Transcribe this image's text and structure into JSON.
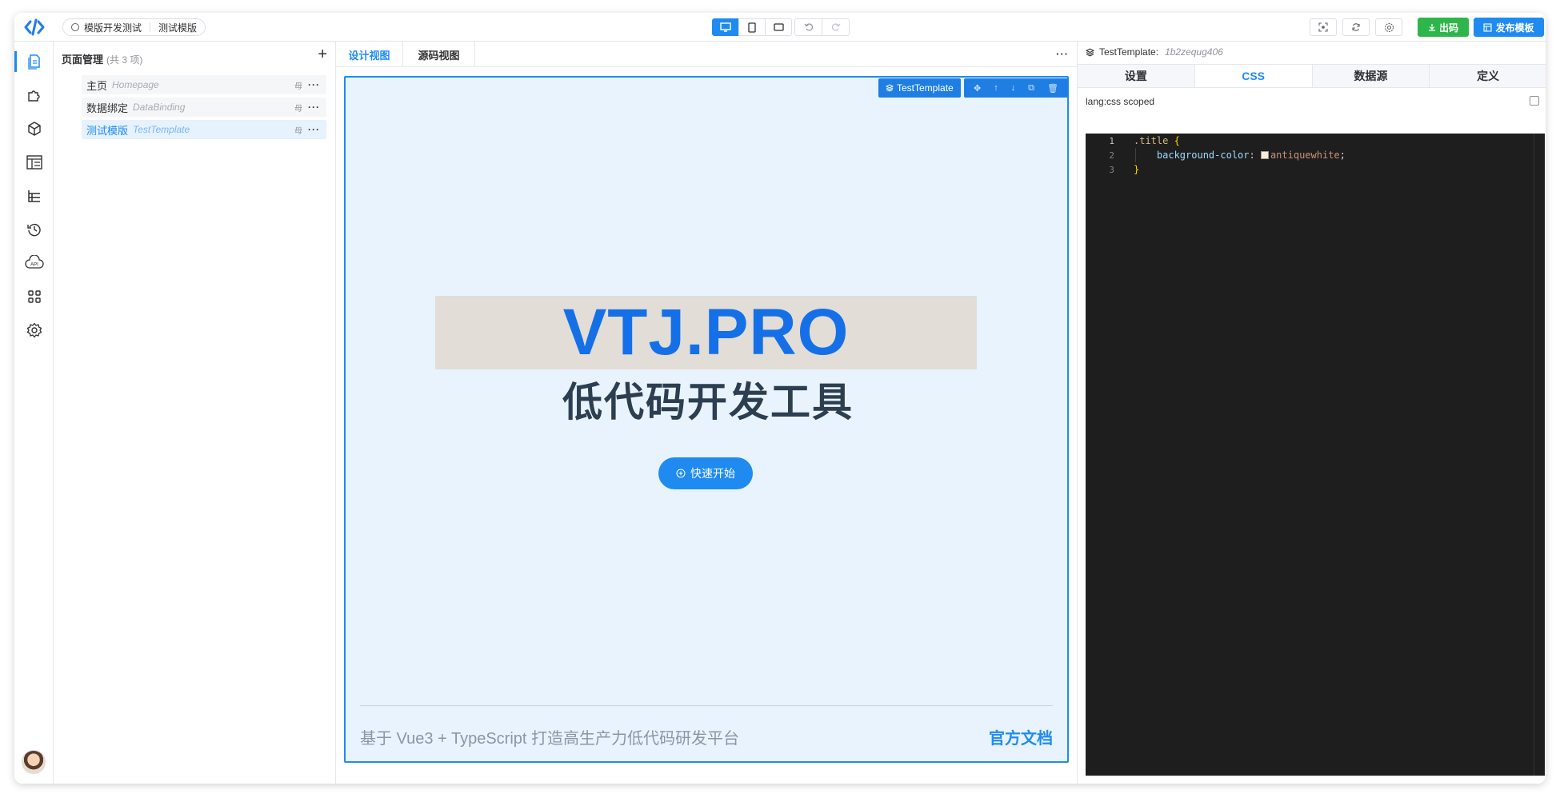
{
  "topbar": {
    "breadcrumb": {
      "project": "模版开发测试",
      "file": "测试模版"
    },
    "export_label": "出码",
    "publish_label": "发布模板"
  },
  "rail": {
    "items": [
      {
        "icon": "pages-icon",
        "active": true
      },
      {
        "icon": "puzzle-icon",
        "active": false
      },
      {
        "icon": "cube-icon",
        "active": false
      },
      {
        "icon": "layout-icon",
        "active": false
      },
      {
        "icon": "tree-icon",
        "active": false
      },
      {
        "icon": "history-icon",
        "active": false
      },
      {
        "icon": "api-cloud-icon",
        "active": false
      },
      {
        "icon": "apps-icon",
        "active": false
      },
      {
        "icon": "settings-icon",
        "active": false
      }
    ]
  },
  "pages": {
    "title": "页面管理",
    "count": "(共 3 项)",
    "items": [
      {
        "cn": "主页",
        "en": "Homepage",
        "mother": "母",
        "active": false
      },
      {
        "cn": "数据绑定",
        "en": "DataBinding",
        "mother": "母",
        "active": false
      },
      {
        "cn": "测试模版",
        "en": "TestTemplate",
        "mother": "母",
        "active": true
      }
    ]
  },
  "center": {
    "tabs": [
      {
        "label": "设计视图",
        "active": true
      },
      {
        "label": "源码视图",
        "active": false
      }
    ],
    "selection_tag": "TestTemplate",
    "hero_title": "VTJ.PRO",
    "hero_subtitle": "低代码开发工具",
    "start_button": "快速开始",
    "footer_text": "基于 Vue3 + TypeScript 打造高生产力低代码研发平台",
    "footer_link": "官方文档"
  },
  "right": {
    "component": "TestTemplate:",
    "component_id": "1b2zequg406",
    "tabs": [
      {
        "label": "设置",
        "active": false
      },
      {
        "label": "CSS",
        "active": true
      },
      {
        "label": "数据源",
        "active": false
      },
      {
        "label": "定义",
        "active": false
      }
    ],
    "lang_label": "lang:css scoped",
    "code_lines": [
      {
        "n": "1",
        "selector": ".title",
        "brace": "{"
      },
      {
        "n": "2",
        "prop": "background-color",
        "value": "antiquewhite"
      },
      {
        "n": "3",
        "brace": "}"
      }
    ]
  },
  "colors": {
    "primary": "#1f8bf0",
    "success": "#2fb64a",
    "canvas_bg": "#e8f3fe",
    "title_bg": "#e2ddd6",
    "editor_bg": "#1e1e1e"
  }
}
